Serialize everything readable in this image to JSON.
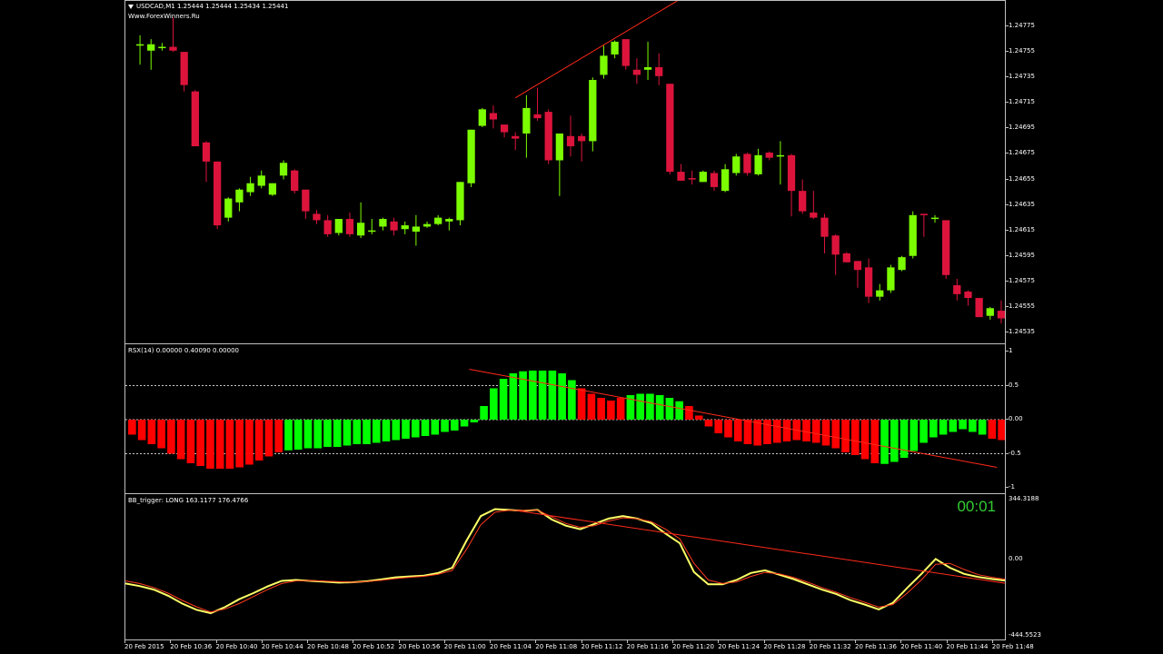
{
  "colors": {
    "bull": "#7cfc00",
    "bear": "#dc143c",
    "hist_up": "#00ff00",
    "hist_dn": "#ff0000",
    "osc": "#ffff66",
    "signal": "#ff3b1f",
    "trend": "#ff2a1a"
  },
  "price_pane": {
    "title": "USDCAD,M1  1.25444 1.25444 1.25434 1.25441",
    "watermark": "Www.ForexWinners.Ru",
    "axis_labels": [
      "1.24775",
      "1.24755",
      "1.24735",
      "1.24715",
      "1.24695",
      "1.24675",
      "1.24655",
      "1.24635",
      "1.24615",
      "1.24595",
      "1.24575",
      "1.24555",
      "1.24535"
    ]
  },
  "rsx_pane": {
    "title": "RSX(14) 0.00000 0.40090 0.00000",
    "axis_labels": [
      "1",
      "0.5",
      "0.00",
      "-0.5",
      "-1"
    ]
  },
  "bb_pane": {
    "title": "BB_trigger: LONG 163.1177 176.4766",
    "timer": "00:01",
    "axis_labels": [
      "344.3188",
      "0.00",
      "-444.5523"
    ]
  },
  "time_axis": [
    "20 Feb 2015",
    "20 Feb 10:36",
    "20 Feb 10:40",
    "20 Feb 10:44",
    "20 Feb 10:48",
    "20 Feb 10:52",
    "20 Feb 10:56",
    "20 Feb 11:00",
    "20 Feb 11:04",
    "20 Feb 11:08",
    "20 Feb 11:12",
    "20 Feb 11:16",
    "20 Feb 11:20",
    "20 Feb 11:24",
    "20 Feb 11:28",
    "20 Feb 11:32",
    "20 Feb 11:36",
    "20 Feb 11:40",
    "20 Feb 11:44",
    "20 Feb 11:48"
  ],
  "chart_data": [
    {
      "type": "candlestick",
      "symbol": "USDCAD",
      "timeframe": "M1",
      "candles": [
        {
          "o": 1.24761,
          "h": 1.24768,
          "l": 1.24745,
          "c": 1.24761
        },
        {
          "o": 1.24756,
          "h": 1.24765,
          "l": 1.24741,
          "c": 1.24761
        },
        {
          "o": 1.24759,
          "h": 1.24762,
          "l": 1.24756,
          "c": 1.24759
        },
        {
          "o": 1.24759,
          "h": 1.24782,
          "l": 1.24755,
          "c": 1.24756
        },
        {
          "o": 1.24755,
          "h": 1.24755,
          "l": 1.24724,
          "c": 1.24729
        },
        {
          "o": 1.24724,
          "h": 1.24725,
          "l": 1.24685,
          "c": 1.24681
        },
        {
          "o": 1.24684,
          "h": 1.24685,
          "l": 1.24653,
          "c": 1.24669
        },
        {
          "o": 1.24669,
          "h": 1.24669,
          "l": 1.24616,
          "c": 1.24619
        },
        {
          "o": 1.24625,
          "h": 1.24641,
          "l": 1.24622,
          "c": 1.2464
        },
        {
          "o": 1.24637,
          "h": 1.24648,
          "l": 1.2463,
          "c": 1.24647
        },
        {
          "o": 1.24645,
          "h": 1.24657,
          "l": 1.24642,
          "c": 1.24652
        },
        {
          "o": 1.2465,
          "h": 1.24662,
          "l": 1.24648,
          "c": 1.24658
        },
        {
          "o": 1.24643,
          "h": 1.24652,
          "l": 1.24642,
          "c": 1.24652
        },
        {
          "o": 1.24658,
          "h": 1.2467,
          "l": 1.24655,
          "c": 1.24668
        },
        {
          "o": 1.24662,
          "h": 1.24663,
          "l": 1.24644,
          "c": 1.24646
        },
        {
          "o": 1.24647,
          "h": 1.24647,
          "l": 1.24624,
          "c": 1.2463
        },
        {
          "o": 1.24628,
          "h": 1.24631,
          "l": 1.2462,
          "c": 1.24623
        },
        {
          "o": 1.24623,
          "h": 1.24627,
          "l": 1.2461,
          "c": 1.24612
        },
        {
          "o": 1.24613,
          "h": 1.24624,
          "l": 1.24611,
          "c": 1.24624
        },
        {
          "o": 1.24624,
          "h": 1.24629,
          "l": 1.2461,
          "c": 1.24612
        },
        {
          "o": 1.24611,
          "h": 1.24637,
          "l": 1.24609,
          "c": 1.24621
        },
        {
          "o": 1.24615,
          "h": 1.24624,
          "l": 1.24612,
          "c": 1.24615
        },
        {
          "o": 1.24618,
          "h": 1.24625,
          "l": 1.24615,
          "c": 1.24624
        },
        {
          "o": 1.24622,
          "h": 1.24625,
          "l": 1.24611,
          "c": 1.24615
        },
        {
          "o": 1.24616,
          "h": 1.24622,
          "l": 1.24612,
          "c": 1.24619
        },
        {
          "o": 1.24614,
          "h": 1.24627,
          "l": 1.24603,
          "c": 1.24618
        },
        {
          "o": 1.24618,
          "h": 1.24622,
          "l": 1.24617,
          "c": 1.2462
        },
        {
          "o": 1.2462,
          "h": 1.24627,
          "l": 1.24619,
          "c": 1.24625
        },
        {
          "o": 1.24622,
          "h": 1.24625,
          "l": 1.24615,
          "c": 1.24624
        },
        {
          "o": 1.24623,
          "h": 1.24653,
          "l": 1.24619,
          "c": 1.24653
        },
        {
          "o": 1.24652,
          "h": 1.24694,
          "l": 1.24649,
          "c": 1.24694
        },
        {
          "o": 1.24697,
          "h": 1.24711,
          "l": 1.24696,
          "c": 1.2471
        },
        {
          "o": 1.24707,
          "h": 1.24713,
          "l": 1.24695,
          "c": 1.24702
        },
        {
          "o": 1.24698,
          "h": 1.24697,
          "l": 1.24688,
          "c": 1.24692
        },
        {
          "o": 1.24689,
          "h": 1.24692,
          "l": 1.24678,
          "c": 1.24687
        },
        {
          "o": 1.24691,
          "h": 1.24721,
          "l": 1.24672,
          "c": 1.24711
        },
        {
          "o": 1.24706,
          "h": 1.24727,
          "l": 1.24701,
          "c": 1.24703
        },
        {
          "o": 1.24708,
          "h": 1.2471,
          "l": 1.24667,
          "c": 1.2467
        },
        {
          "o": 1.2467,
          "h": 1.24689,
          "l": 1.24642,
          "c": 1.24691
        },
        {
          "o": 1.24689,
          "h": 1.24705,
          "l": 1.24673,
          "c": 1.24681
        },
        {
          "o": 1.24689,
          "h": 1.24691,
          "l": 1.24669,
          "c": 1.24685
        },
        {
          "o": 1.24685,
          "h": 1.24735,
          "l": 1.24677,
          "c": 1.24733
        },
        {
          "o": 1.24737,
          "h": 1.2476,
          "l": 1.24734,
          "c": 1.24752
        },
        {
          "o": 1.24753,
          "h": 1.24764,
          "l": 1.2475,
          "c": 1.24763
        },
        {
          "o": 1.24765,
          "h": 1.24761,
          "l": 1.24741,
          "c": 1.24744
        },
        {
          "o": 1.24741,
          "h": 1.2475,
          "l": 1.2473,
          "c": 1.24737
        },
        {
          "o": 1.24741,
          "h": 1.24763,
          "l": 1.24733,
          "c": 1.24743
        },
        {
          "o": 1.24743,
          "h": 1.24754,
          "l": 1.24729,
          "c": 1.24736
        },
        {
          "o": 1.2473,
          "h": 1.2473,
          "l": 1.24659,
          "c": 1.24661
        },
        {
          "o": 1.24661,
          "h": 1.24667,
          "l": 1.24654,
          "c": 1.24654
        },
        {
          "o": 1.24656,
          "h": 1.24662,
          "l": 1.24651,
          "c": 1.24655
        },
        {
          "o": 1.24653,
          "h": 1.24662,
          "l": 1.24653,
          "c": 1.24661
        },
        {
          "o": 1.2466,
          "h": 1.24662,
          "l": 1.24646,
          "c": 1.24649
        },
        {
          "o": 1.24646,
          "h": 1.24667,
          "l": 1.24645,
          "c": 1.24663
        },
        {
          "o": 1.2466,
          "h": 1.24675,
          "l": 1.24658,
          "c": 1.24673
        },
        {
          "o": 1.24675,
          "h": 1.24676,
          "l": 1.24658,
          "c": 1.2466
        },
        {
          "o": 1.24659,
          "h": 1.24679,
          "l": 1.24658,
          "c": 1.24674
        },
        {
          "o": 1.24676,
          "h": 1.24677,
          "l": 1.2467,
          "c": 1.24672
        },
        {
          "o": 1.24673,
          "h": 1.24685,
          "l": 1.24651,
          "c": 1.24674
        },
        {
          "o": 1.24674,
          "h": 1.24675,
          "l": 1.24626,
          "c": 1.24646
        },
        {
          "o": 1.24646,
          "h": 1.24655,
          "l": 1.24628,
          "c": 1.2463
        },
        {
          "o": 1.24629,
          "h": 1.24646,
          "l": 1.24624,
          "c": 1.24625
        },
        {
          "o": 1.24625,
          "h": 1.24628,
          "l": 1.24597,
          "c": 1.2461
        },
        {
          "o": 1.24611,
          "h": 1.24612,
          "l": 1.2458,
          "c": 1.24596
        },
        {
          "o": 1.24597,
          "h": 1.24598,
          "l": 1.2459,
          "c": 1.2459
        },
        {
          "o": 1.24591,
          "h": 1.24591,
          "l": 1.2457,
          "c": 1.24584
        },
        {
          "o": 1.24586,
          "h": 1.24593,
          "l": 1.24558,
          "c": 1.24563
        },
        {
          "o": 1.24563,
          "h": 1.24573,
          "l": 1.2456,
          "c": 1.24568
        },
        {
          "o": 1.24568,
          "h": 1.24588,
          "l": 1.24566,
          "c": 1.24586
        },
        {
          "o": 1.24584,
          "h": 1.24595,
          "l": 1.24583,
          "c": 1.24594
        },
        {
          "o": 1.24595,
          "h": 1.2463,
          "l": 1.24593,
          "c": 1.24627
        },
        {
          "o": 1.24628,
          "h": 1.24628,
          "l": 1.2461,
          "c": 1.24627
        },
        {
          "o": 1.24624,
          "h": 1.24627,
          "l": 1.24621,
          "c": 1.24625
        },
        {
          "o": 1.24623,
          "h": 1.24623,
          "l": 1.24577,
          "c": 1.2458
        },
        {
          "o": 1.24572,
          "h": 1.24577,
          "l": 1.2456,
          "c": 1.24565
        },
        {
          "o": 1.24567,
          "h": 1.24568,
          "l": 1.24556,
          "c": 1.24562
        },
        {
          "o": 1.24562,
          "h": 1.24562,
          "l": 1.2455,
          "c": 1.24547
        },
        {
          "o": 1.24548,
          "h": 1.24555,
          "l": 1.24545,
          "c": 1.24554
        },
        {
          "o": 1.24552,
          "h": 1.2456,
          "l": 1.24542,
          "c": 1.24546
        }
      ],
      "trendline": [
        {
          "bar": 34,
          "price": 1.24719
        },
        {
          "bar": 50,
          "price": 1.24802
        }
      ],
      "ylim": [
        1.24525,
        1.24795
      ]
    },
    {
      "type": "bar",
      "name": "RSX(14)",
      "values": [
        -0.22,
        -0.3,
        -0.36,
        -0.42,
        -0.5,
        -0.58,
        -0.64,
        -0.68,
        -0.72,
        -0.72,
        -0.72,
        -0.7,
        -0.66,
        -0.6,
        -0.54,
        -0.48,
        -0.45,
        -0.44,
        -0.42,
        -0.42,
        -0.4,
        -0.4,
        -0.38,
        -0.36,
        -0.36,
        -0.34,
        -0.32,
        -0.3,
        -0.28,
        -0.26,
        -0.24,
        -0.22,
        -0.18,
        -0.16,
        -0.1,
        -0.04,
        0.2,
        0.46,
        0.6,
        0.68,
        0.71,
        0.72,
        0.72,
        0.72,
        0.68,
        0.58,
        0.46,
        0.38,
        0.32,
        0.28,
        0.32,
        0.36,
        0.38,
        0.38,
        0.36,
        0.32,
        0.27,
        0.2,
        0.06,
        -0.1,
        -0.2,
        -0.26,
        -0.32,
        -0.36,
        -0.38,
        -0.36,
        -0.34,
        -0.32,
        -0.3,
        -0.32,
        -0.34,
        -0.38,
        -0.42,
        -0.48,
        -0.52,
        -0.58,
        -0.64,
        -0.65,
        -0.62,
        -0.56,
        -0.46,
        -0.34,
        -0.26,
        -0.22,
        -0.18,
        -0.14,
        -0.18,
        -0.22,
        -0.28,
        -0.3
      ],
      "colors_by_bar": "dddddddddddddddduuuuuuuuuuuuuuuuuuuuuuuuuuuuuuddddduuuuuudddddddddddddddddddduuuuuuuuuuudddddd",
      "levels": [
        0.5,
        0,
        -0.5
      ],
      "trendline": [
        {
          "bar": 35,
          "value": 0.74
        },
        {
          "bar": 89,
          "value": -0.7
        }
      ],
      "ylim": [
        -1,
        1
      ]
    },
    {
      "type": "line",
      "name": "BB_trigger",
      "series": [
        {
          "values": [
            -135,
            -150,
            -170,
            -205,
            -250,
            -285,
            -305,
            -270,
            -225,
            -190,
            -152,
            -120,
            -115,
            -120,
            -125,
            -130,
            -128,
            -122,
            -112,
            -100,
            -95,
            -90,
            -75,
            -45,
            110,
            250,
            290,
            285,
            280,
            285,
            230,
            195,
            175,
            205,
            236,
            250,
            236,
            210,
            150,
            95,
            -70,
            -140,
            -140,
            -115,
            -75,
            -60,
            -85,
            -110,
            -140,
            -170,
            -195,
            -230,
            -255,
            -283,
            -245,
            -160,
            -80,
            5,
            -45,
            -80,
            -98,
            -110,
            -119
          ]
        },
        {
          "values": [
            -120,
            -135,
            -158,
            -190,
            -232,
            -268,
            -298,
            -281,
            -250,
            -210,
            -170,
            -135,
            -120,
            -118,
            -121,
            -125,
            -128,
            -124,
            -117,
            -107,
            -100,
            -94,
            -83,
            -60,
            60,
            200,
            272,
            283,
            282,
            283,
            245,
            208,
            186,
            195,
            222,
            240,
            235,
            218,
            175,
            120,
            -20,
            -115,
            -135,
            -126,
            -95,
            -72,
            -80,
            -100,
            -128,
            -158,
            -185,
            -215,
            -242,
            -270,
            -255,
            -190,
            -115,
            -25,
            -20,
            -55,
            -85,
            -100,
            -112
          ]
        }
      ],
      "trendline": [
        {
          "x": 0.4428,
          "value": 282
        },
        {
          "x": 1.0,
          "value": -135
        }
      ],
      "ylim": [
        -444.5523,
        344.3188
      ]
    }
  ]
}
